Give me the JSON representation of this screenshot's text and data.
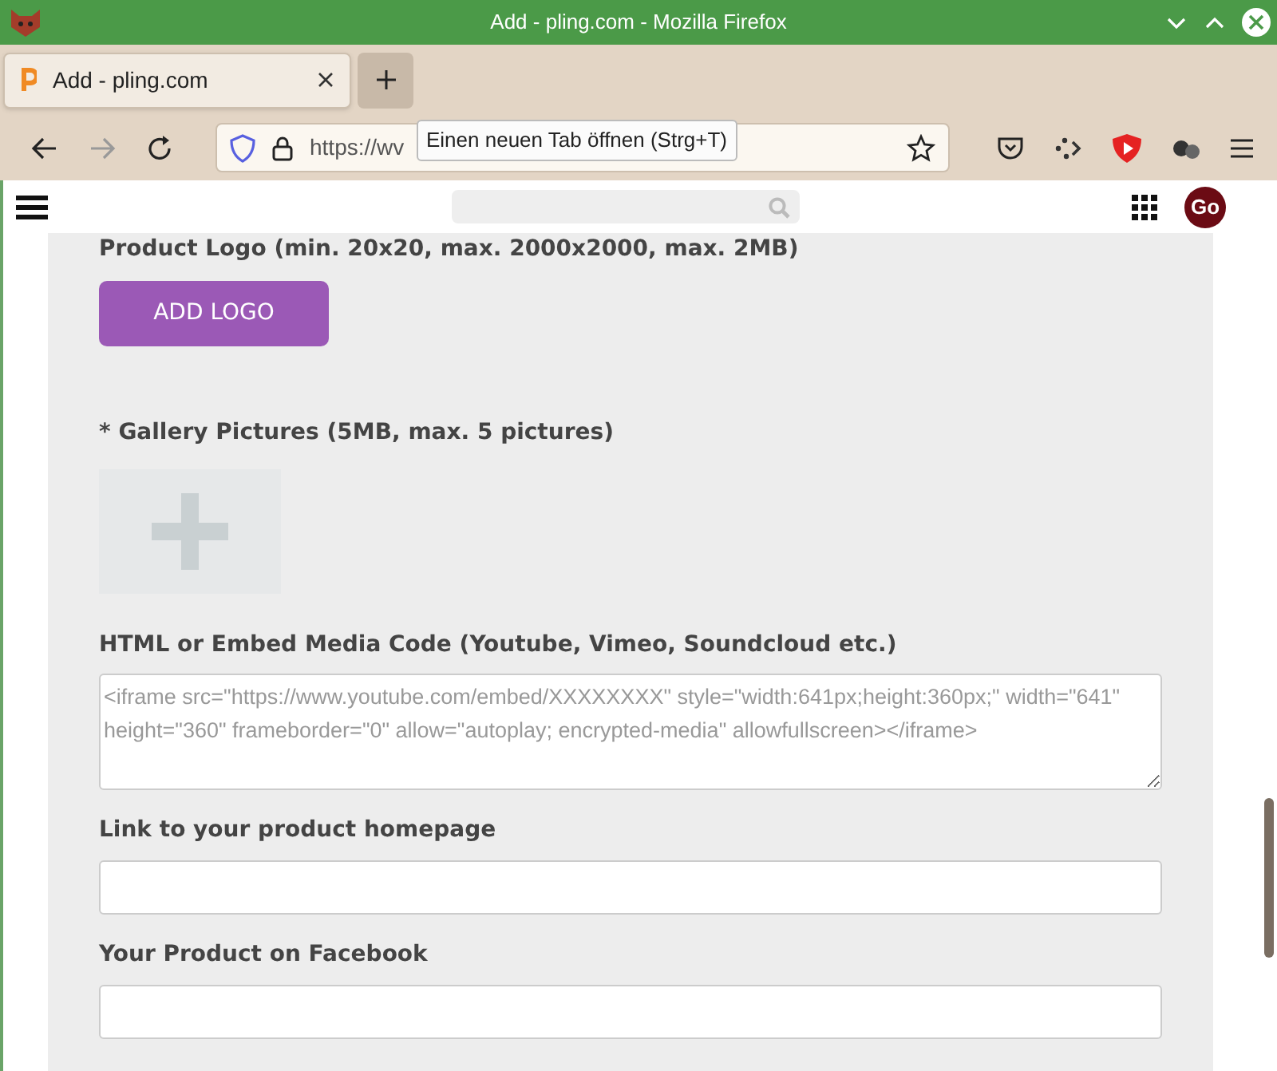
{
  "window": {
    "title": "Add - pling.com - Mozilla Firefox"
  },
  "tabs": [
    {
      "label": "Add - pling.com",
      "selected": true
    }
  ],
  "new_tab_tooltip": "Einen neuen Tab öffnen (Strg+T)",
  "address_bar": {
    "url": "https://wv"
  },
  "site_header": {
    "avatar": "Go"
  },
  "form": {
    "logo_heading": "Product Logo (min. 20x20, max. 2000x2000, max. 2MB)",
    "add_logo_button": "ADD LOGO",
    "gallery_heading": "* Gallery Pictures (5MB, max. 5 pictures)",
    "embed_heading": "HTML or Embed Media Code (Youtube, Vimeo, Soundcloud etc.)",
    "embed_placeholder": "<iframe src=\"https://www.youtube.com/embed/XXXXXXXX\" style=\"width:641px;height:360px;\" width=\"641\" height=\"360\" frameborder=\"0\" allow=\"autoplay; encrypted-media\" allowfullscreen></iframe>",
    "fields": [
      {
        "label": "Link to your product homepage"
      },
      {
        "label": "Your Product on Facebook"
      }
    ]
  }
}
